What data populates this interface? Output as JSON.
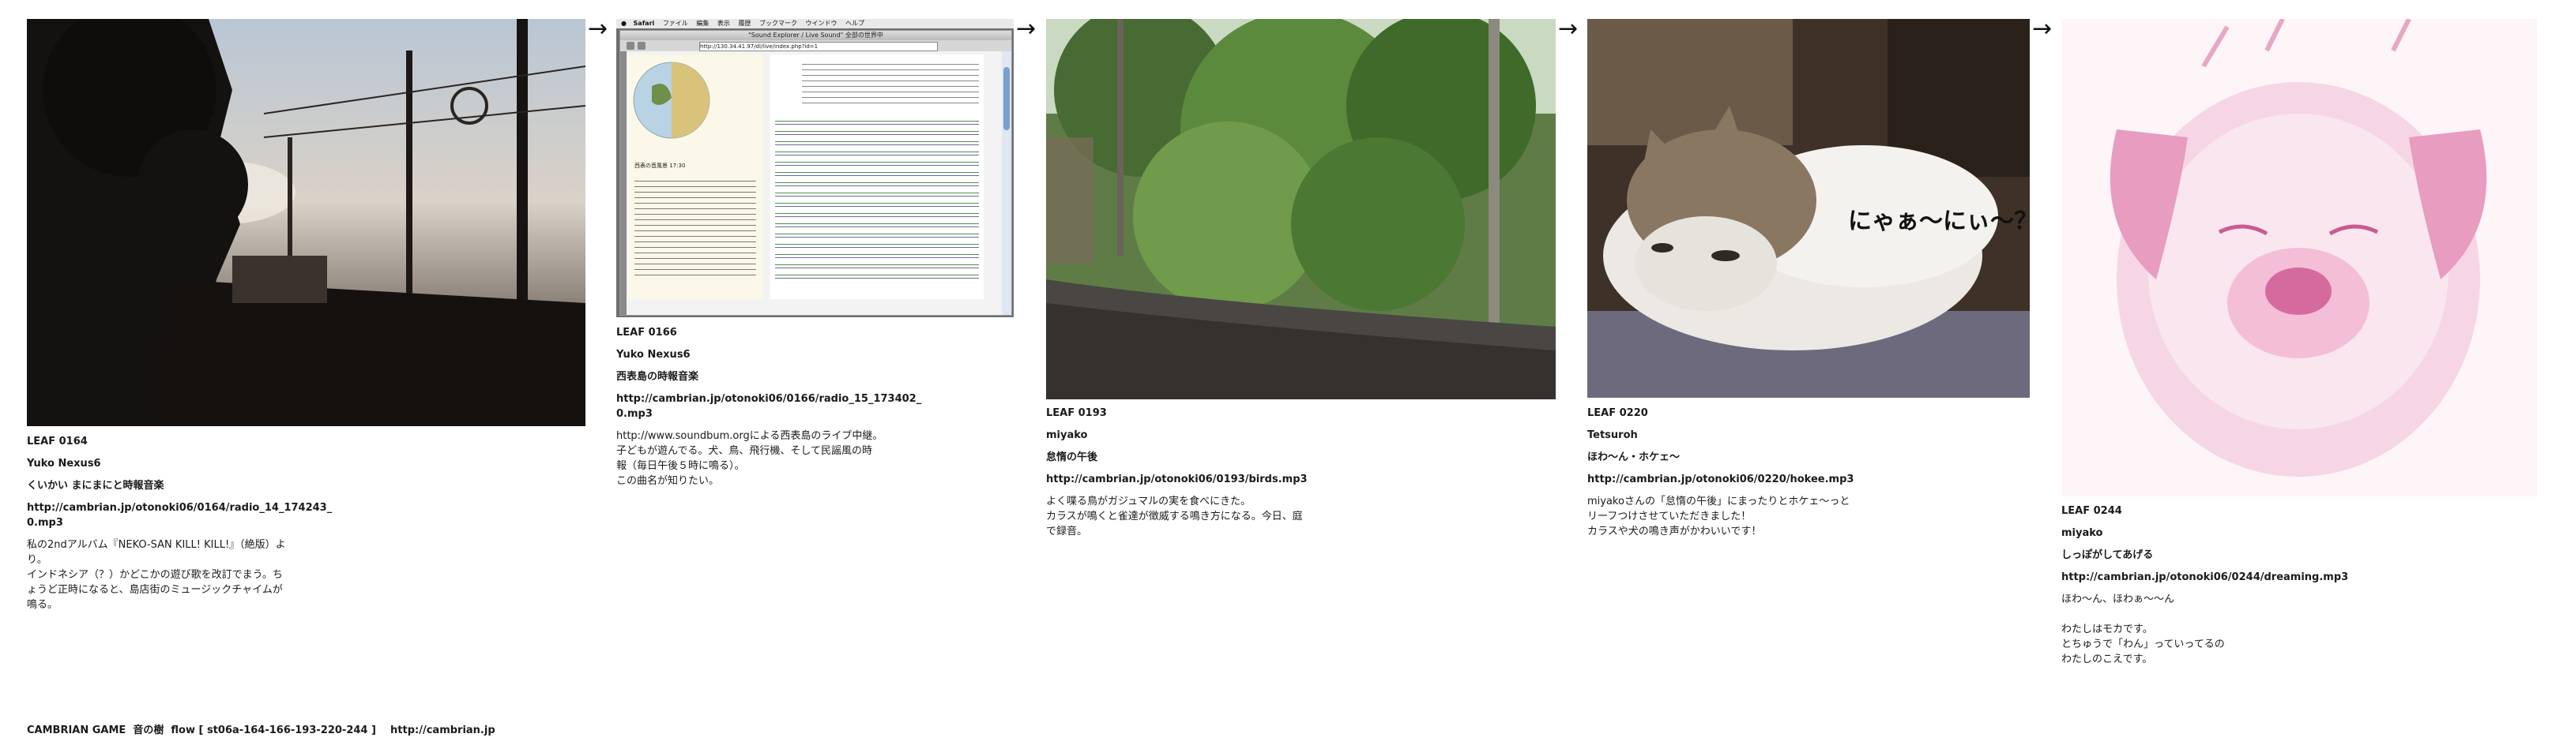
{
  "leaves": [
    {
      "id": "LEAF 0164",
      "author": "Yuko Nexus6",
      "title": "くいかい まにまにと時報音楽",
      "url": "http://cambrian.jp/otonoki06/0164/radio_14_174243_\n0.mp3",
      "comment": "私の2ndアルバム『NEKO-SAN KILL! KILL!』（絶版）よ\nり。\nインドネシア（？）かどこかの遊び歌を改訂でまう。ち\nょうど正時になると、島店街のミュージックチャイムが\n鳴る。"
    },
    {
      "id": "LEAF 0166",
      "author": "Yuko Nexus6",
      "title": "西表島の時報音楽",
      "url": "http://cambrian.jp/otonoki06/0166/radio_15_173402_\n0.mp3",
      "comment": "http://www.soundbum.orgによる西表島のライブ中継。\n子どもが遊んでる。犬、鳥、飛行機、そして民謡風の時\n報（毎日午後５時に鳴る）。\nこの曲名が知りたい。"
    },
    {
      "id": "LEAF 0193",
      "author": "miyako",
      "title": "怠惰の午後",
      "url": "http://cambrian.jp/otonoki06/0193/birds.mp3",
      "comment": "よく喋る鳥がガジュマルの実を食べにきた。\nカラスが鳴くと雀達が徴威する鳴き方になる。今日、庭\nで録音。"
    },
    {
      "id": "LEAF 0220",
      "author": "Tetsuroh",
      "title": "ほわ〜ん・ホケェ〜",
      "url": "http://cambrian.jp/otonoki06/0220/hokee.mp3",
      "comment": "miyakoさんの「怠惰の午後」にまったりとホケェ〜っと\nリーフつけさせていただきました！\nカラスや犬の鳴き声がかわいいです！"
    },
    {
      "id": "LEAF 0244",
      "author": "miyako",
      "title": "しっぽがしてあげる",
      "url": "http://cambrian.jp/otonoki06/0244/dreaming.mp3",
      "comment": "ほわ〜ん、ほわぁ〜〜ん\n\nわたしはモカです。\nとちゅうで「わん」っていってるの\nわたしのこえです。"
    }
  ],
  "screenshot": {
    "menu_items": [
      "Safari",
      "ファイル",
      "編集",
      "表示",
      "履歴",
      "ブックマーク",
      "ウインドウ",
      "ヘルプ"
    ],
    "window_title": "\"Sound Explorer / Live Sound\" 全部の世界中",
    "address": "http://130.34.41.97/dl/live/index.php?id=1",
    "site_title": "世界の音を聴き",
    "caption": "西表の音風景 17:30"
  },
  "overlay_caption": "にゃぁ〜にぃ〜？",
  "arrows": [
    "→",
    "→",
    "→",
    "→"
  ],
  "footer": "CAMBRIAN GAME  音の樹  flow [ st06a-164-166-193-220-244 ]    http://cambrian.jp"
}
